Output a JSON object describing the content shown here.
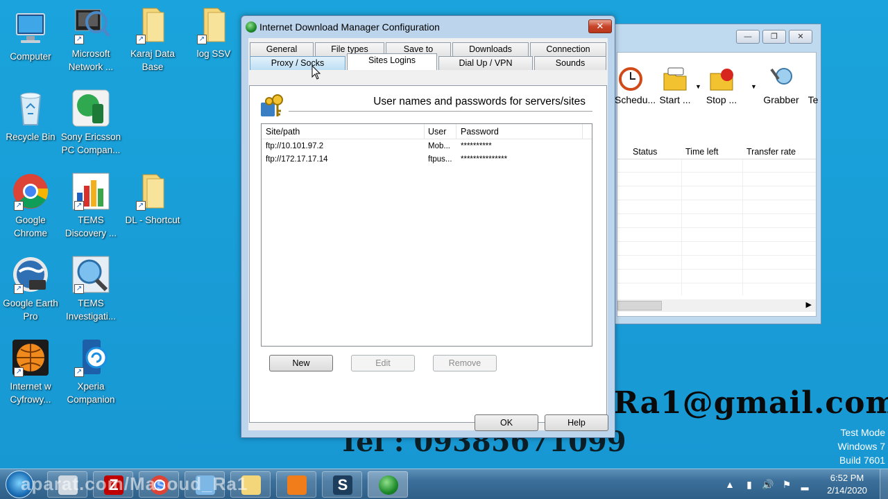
{
  "desktop": {
    "icons": [
      {
        "label": "Computer"
      },
      {
        "label": "Microsoft Network ..."
      },
      {
        "label": "Karaj Data Base"
      },
      {
        "label": "log SSV"
      },
      {
        "label": "Recycle Bin"
      },
      {
        "label": "Sony Ericsson PC Compan..."
      },
      {
        "label": "Google Chrome"
      },
      {
        "label": "TEMS Discovery ..."
      },
      {
        "label": "DL - Shortcut"
      },
      {
        "label": "Google Earth Pro"
      },
      {
        "label": "TEMS Investigati..."
      },
      {
        "label": "Internet w Cyfrowy..."
      },
      {
        "label": "Xperia Companion"
      }
    ],
    "overlay_email": "Ra1@gmail.com",
    "overlay_tel": "Tel : 09385671099",
    "test_mode": [
      "Test Mode",
      "Windows 7",
      "Build 7601"
    ]
  },
  "idm_main": {
    "toolbar": [
      {
        "label": "Schedu...",
        "icon": "clock-icon"
      },
      {
        "label": "Start ...",
        "icon": "start-queue-icon"
      },
      {
        "label": "Stop ...",
        "icon": "stop-queue-icon"
      },
      {
        "label": "Grabber",
        "icon": "grabber-icon"
      },
      {
        "label": "Te",
        "icon": "tell-friend-icon"
      }
    ],
    "columns": [
      "Status",
      "Time left",
      "Transfer rate"
    ],
    "minimize": "—",
    "restore": "❐",
    "close": "✕"
  },
  "dialog": {
    "title": "Internet Download Manager Configuration",
    "close": "✕",
    "tabs_row1": [
      "General",
      "File types",
      "Save to",
      "Downloads",
      "Connection"
    ],
    "tabs_row2": [
      "Proxy / Socks",
      "Sites Logins",
      "Dial Up / VPN",
      "Sounds"
    ],
    "active_tab": "Sites Logins",
    "heading": "User names and passwords for servers/sites",
    "list": {
      "columns": [
        "Site/path",
        "User",
        "Password"
      ],
      "rows": [
        {
          "site": "ftp://10.101.97.2",
          "user": "Mob...",
          "password": "**********"
        },
        {
          "site": "ftp://172.17.17.14",
          "user": "ftpus...",
          "password": "***************"
        }
      ]
    },
    "buttons": {
      "new": "New",
      "edit": "Edit",
      "remove": "Remove",
      "ok": "OK",
      "help": "Help"
    }
  },
  "taskbar": {
    "watermark": "aparat.com/Masoud_Ra1",
    "clock_time": "6:52 PM",
    "clock_date": "2/14/2020",
    "tray_chevron": "▲"
  }
}
